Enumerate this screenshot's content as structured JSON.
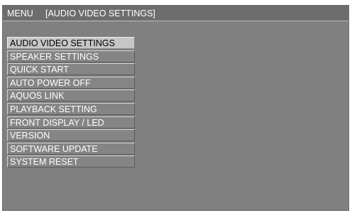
{
  "header": {
    "menu_label": "MENU",
    "section_label": "[AUDIO VIDEO SETTINGS]"
  },
  "menu": {
    "selected_index": 0,
    "items": [
      {
        "label": "AUDIO VIDEO SETTINGS"
      },
      {
        "label": "SPEAKER SETTINGS"
      },
      {
        "label": "QUICK START"
      },
      {
        "label": "AUTO POWER OFF"
      },
      {
        "label": "AQUOS LINK"
      },
      {
        "label": "PLAYBACK SETTING"
      },
      {
        "label": "FRONT DISPLAY / LED"
      },
      {
        "label": "VERSION"
      },
      {
        "label": "SOFTWARE UPDATE"
      },
      {
        "label": "SYSTEM RESET"
      }
    ]
  },
  "colors": {
    "screen_background": "#808080",
    "header_background": "#6d6d6d",
    "selected_item_background": "#c6c6c6",
    "item_text": "#ffffff",
    "selected_item_text": "#000000"
  }
}
